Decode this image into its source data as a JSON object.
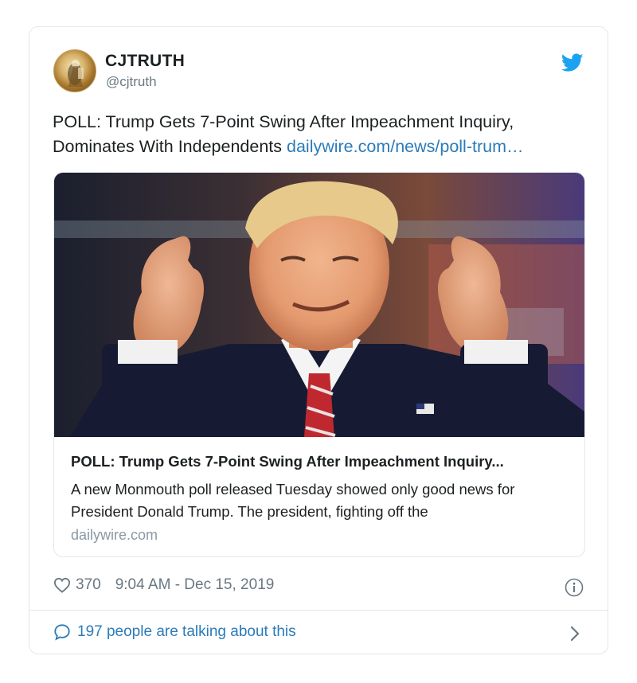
{
  "tweet": {
    "display_name": "CJTRUTH",
    "handle": "@cjtruth",
    "text_main": "POLL: Trump Gets 7-Point Swing After Impeachment Inquiry, Dominates With Independents ",
    "text_link": "dailywire.com/news/poll-trum…"
  },
  "link_card": {
    "title": "POLL: Trump Gets 7-Point Swing After Impeachment Inquiry...",
    "description": "A new Monmouth poll released Tuesday showed only good news for President Donald Trump. The president, fighting off the",
    "domain": "dailywire.com"
  },
  "footer": {
    "like_count": "370",
    "timestamp": "9:04 AM - Dec 15, 2019",
    "talking_text": "197 people are talking about this"
  },
  "colors": {
    "link": "#2b7bb9",
    "muted": "#697882",
    "border": "#e1e8ed",
    "twitter_blue": "#1da1f2"
  },
  "icons": [
    "twitter-bird-icon",
    "heart-icon",
    "info-icon",
    "chat-bubble-icon",
    "chevron-right-icon"
  ]
}
